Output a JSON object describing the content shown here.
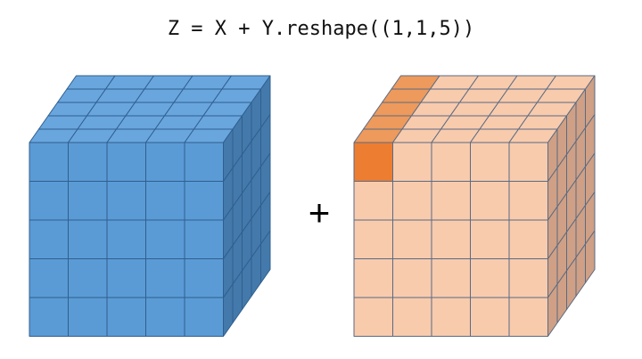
{
  "title": "Z = X + Y.reshape((1,1,5))",
  "operator": "+",
  "grid_size": 5,
  "cubes": [
    {
      "name": "x-array-cube",
      "colors": {
        "front": "#5b9bd5",
        "top": "#6aa6de",
        "side": "#4479ab",
        "edge": "#2f5f8f"
      },
      "highlight_column": null
    },
    {
      "name": "y-broadcast-cube",
      "colors": {
        "front": "#f8cbad",
        "top": "#f8cbad",
        "side": "#cfa085",
        "edge": "#5a6a82"
      },
      "highlight_column": {
        "row": 0,
        "col": 0,
        "color_front": "#ed7d31",
        "color_top": "#ed9a5c"
      }
    }
  ]
}
